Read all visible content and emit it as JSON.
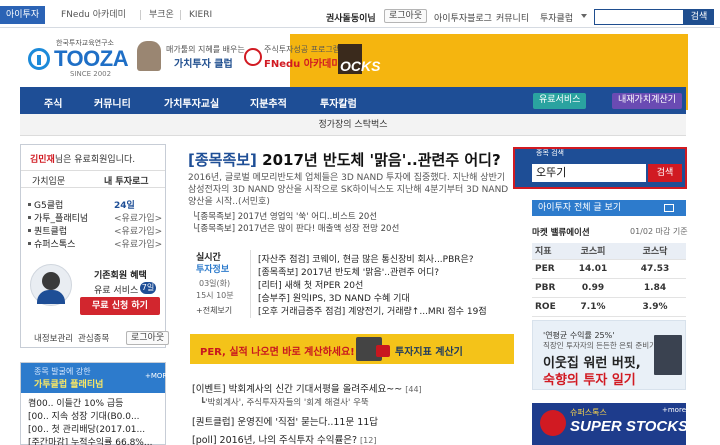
{
  "topbar": {
    "tabs": [
      "아이투자",
      "FNedu 아카데미",
      "부크온",
      "KIERI"
    ],
    "user": "권사돌동이님",
    "logout": "로그아웃",
    "links": [
      "아이투자블로그",
      "커뮤니티",
      "투자클럽"
    ],
    "search_btn": "검색"
  },
  "logo": {
    "top": "한국투자교육연구소",
    "word": "TOOZA",
    "since": "SINCE 2002"
  },
  "promos": [
    {
      "small": "매가툴의 지혜를 배우는",
      "big": "가치투자 클럽"
    },
    {
      "small": "주식투자성공 프로그램",
      "big": "FNedu 아카데미"
    }
  ],
  "banner_text": "OCKS",
  "nav": {
    "items": [
      "주식",
      "커뮤니티",
      "가치투자교실",
      "지분추적",
      "투자칼럼"
    ],
    "btn1": "유료서비스",
    "btn2": "내재가치계산기",
    "sub": "정가장의 스탁벅스"
  },
  "left": {
    "greet_name": "김민재",
    "greet_rest": "님은 유료회원입니다.",
    "tab_a": "가치입문",
    "tab_b": "내 투자로그",
    "rows": [
      {
        "label": "G5클럽",
        "value": "24일"
      },
      {
        "label": "가투_플래티넘",
        "value": "<유료가입>"
      },
      {
        "label": "퀀트클럽",
        "value": "<유료가입>"
      },
      {
        "label": "슈퍼스톡스",
        "value": "<유료가입>"
      }
    ],
    "benefit_title": "기존회원 혜택",
    "benefit_sub": "유료 서비스",
    "benefit_days": "7일",
    "trial_btn": "무료 신청 하기",
    "info_link": "내정보관리",
    "interest_link": "관심종목",
    "logout_btn": "로그아웃",
    "box2_t1": "종목 발굴에 강한",
    "box2_t2": "가투클럽 플래티넘",
    "box2_more": "+MORE",
    "news": [
      "켬00.. 이들간 10% 급등",
      "[00.. 지속 성장 기대(B0.0...",
      "[00.. 첫 관리배당(2017.01...",
      "[주간마감] 누적수익률 66.8%..."
    ]
  },
  "center": {
    "headline_bracket": "[종목족보]",
    "headline_rest": " 2017년 반도체 '맑음'..관련주 어디?",
    "desc": [
      "2016년, 글로벌 메모리반도체 업체들은 3D NAND 투자에 집중했다. 지난해 상반기",
      "삼성전자의 3D NAND 양산을 시작으로 SK하이닉스도 지난해 4분기부터 3D NAND",
      "양산을 시작..(서민호)"
    ],
    "subs": [
      "└[종목족보] 2017년 영업익 '쑥' 어디..비스트 20선",
      "└[종목족보] 2017년은 많이 판다! 매출액 성장 전망 20선"
    ],
    "rt_label": "실시간",
    "rt_label2": "투자정보",
    "rt_date": "03일(화)",
    "rt_time": "15시 10분",
    "rt_more": "+전체보기",
    "rt_items": [
      "[자산주 점검] 코웨이, 현금 많은 통신장비 회사...PBR은?",
      "[종목족보] 2017년 반도체 '맑음'..관련주 어디?",
      "[리터] 새해 첫 저PER 20선",
      "[승부주] 원익IPS, 3D NAND 수혜 기대",
      "[오후 거래급증주 점검] 계양전기, 거래량↑...MRI 점수 19점"
    ],
    "yb_t1": "PER, 실적 나오면 바로 계산하세요!",
    "yb_t2": "투자지표 계산기",
    "bottom": [
      {
        "text": "[이벤트] 박회계사의 신간 기대서평을 올려주세요~~",
        "cnt": "[44]"
      },
      {
        "text": "[퀀트클럽] 운영진에 '직접' 묻는다..11문 11답",
        "cnt": ""
      },
      {
        "text": "[poll] 2016년, 나의 주식투자 수익률은?",
        "cnt": "[12]"
      }
    ],
    "bottom_subs": [
      "┗'박회계사', 주식투자자들의 '회계 해결사' 우뚝"
    ]
  },
  "right": {
    "search_label": "종목 검색",
    "search_value": "오뚜기",
    "search_btn": "검색",
    "bluebar": "아이투자 전체 글 보기",
    "market_title": "마켓 밸류에이션",
    "market_date": "01/02 마감 기준",
    "headers": [
      "지표",
      "코스피",
      "코스닥"
    ],
    "rows": [
      {
        "k": "PER",
        "a": "14.01",
        "b": "47.53"
      },
      {
        "k": "PBR",
        "a": "0.99",
        "b": "1.84"
      },
      {
        "k": "ROE",
        "a": "7.1%",
        "b": "3.9%"
      }
    ],
    "ad_t1": "'연평균 수익률 25%'",
    "ad_t2": "직장인 투자자의 든든한 은퇴 준비기",
    "ad_t3": "이웃집 워런 버핏,",
    "ad_t4": "숙향의 투자 일기",
    "ad2_t1": "슈퍼스톡스",
    "ad2_t2": "SUPER STOCKS",
    "ad2_more": "+more"
  },
  "colors": {
    "brand": "#1e4e96",
    "accent_red": "#d11a22",
    "banner": "#f5b50f"
  }
}
